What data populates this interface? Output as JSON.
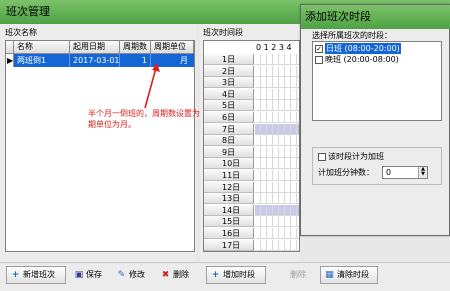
{
  "main_title": "班次管理",
  "left": {
    "label": "班次名称",
    "columns": [
      "名称",
      "起用日期",
      "周期数",
      "周期单位"
    ],
    "rows": [
      {
        "indicator": "▶",
        "name": "两班倒1",
        "start_date": "2017-03-01",
        "cycle": "1",
        "unit": "月"
      }
    ]
  },
  "annotation": "半个月一倒班的，周期数设置为1，周期单位为月。",
  "schedule": {
    "label": "班次时间段",
    "hours": "0 1 2 3 4",
    "days": [
      "1日",
      "2日",
      "3日",
      "4日",
      "5日",
      "6日",
      "7日",
      "8日",
      "9日",
      "10日",
      "11日",
      "12日",
      "13日",
      "14日",
      "15日",
      "16日",
      "17日"
    ],
    "highlight_days": [
      "7日",
      "14日"
    ]
  },
  "dialog": {
    "title": "添加班次时段",
    "list_label": "选择所属班次的时段：",
    "items": [
      {
        "checked": true,
        "selected": true,
        "label": "日班 (08:00-20:00)"
      },
      {
        "checked": false,
        "selected": false,
        "label": "晚班 (20:00-08:00)"
      }
    ],
    "overtime_label": "该时段计为加班",
    "overtime_minutes_label": "计加班分钟数：",
    "overtime_minutes_value": "0"
  },
  "buttons": {
    "add_shift": "新增班次",
    "save": "保存",
    "edit": "修改",
    "delete": "删除",
    "add_period": "增加时段",
    "delete_period": "删除",
    "clear_period": "清除时段"
  },
  "colors": {
    "title_bar": "#4ea243",
    "selection": "#1466d6",
    "annotation": "#e31b1b"
  }
}
